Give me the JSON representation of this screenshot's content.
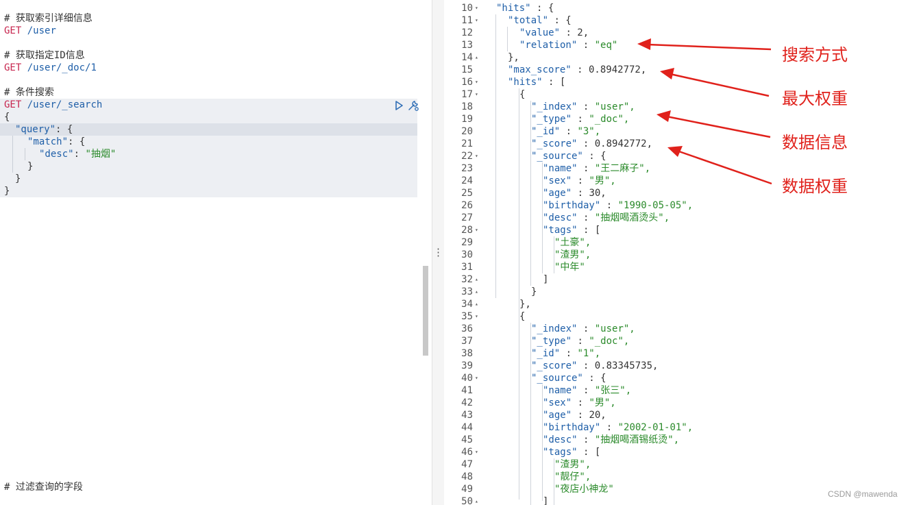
{
  "left_editor": {
    "lines": [
      {
        "comment": "# 获取索引详细信息"
      },
      {
        "method": "GET",
        "path": "/user"
      },
      {
        "comment": "# 获取指定ID信息"
      },
      {
        "method": "GET",
        "path": "/user/_doc/1"
      },
      {
        "comment": "# 条件搜索"
      },
      {
        "method": "GET",
        "path": "/user/_search"
      },
      {
        "text": "{"
      },
      {
        "key": "\"query\"",
        "rest": ": {"
      },
      {
        "key": "\"match\"",
        "rest": ": {"
      },
      {
        "key": "\"desc\"",
        "sep": ": ",
        "value": "\"抽烟\""
      },
      {
        "text": "}"
      },
      {
        "text": "}"
      },
      {
        "text": "}"
      },
      {
        "comment": "# 过滤查询的字段"
      }
    ],
    "icons": {
      "run": "play-icon",
      "settings": "wrench-icon"
    }
  },
  "splitter": {
    "handle": "⋮"
  },
  "right_output": {
    "lines": [
      {
        "n": "10",
        "fold": "▾",
        "t": "\"hits\" : {"
      },
      {
        "n": "11",
        "fold": "▾",
        "t": "\"total\" : {"
      },
      {
        "n": "12",
        "t": "\"value\" : 2,"
      },
      {
        "n": "13",
        "t": "\"relation\" : \"eq\""
      },
      {
        "n": "14",
        "fold": "▴",
        "t": "},"
      },
      {
        "n": "15",
        "t": "\"max_score\" : 0.8942772,"
      },
      {
        "n": "16",
        "fold": "▾",
        "t": "\"hits\" : ["
      },
      {
        "n": "17",
        "fold": "▾",
        "t": "{"
      },
      {
        "n": "18",
        "t": "\"_index\" : \"user\","
      },
      {
        "n": "19",
        "t": "\"_type\" : \"_doc\","
      },
      {
        "n": "20",
        "t": "\"_id\" : \"3\","
      },
      {
        "n": "21",
        "t": "\"_score\" : 0.8942772,"
      },
      {
        "n": "22",
        "fold": "▾",
        "t": "\"_source\" : {"
      },
      {
        "n": "23",
        "t": "\"name\" : \"王二麻子\","
      },
      {
        "n": "24",
        "t": "\"sex\" : \"男\","
      },
      {
        "n": "25",
        "t": "\"age\" : 30,"
      },
      {
        "n": "26",
        "t": "\"birthday\" : \"1990-05-05\","
      },
      {
        "n": "27",
        "t": "\"desc\" : \"抽烟喝酒烫头\","
      },
      {
        "n": "28",
        "fold": "▾",
        "t": "\"tags\" : ["
      },
      {
        "n": "29",
        "t": "\"土豪\","
      },
      {
        "n": "30",
        "t": "\"渣男\","
      },
      {
        "n": "31",
        "t": "\"中年\""
      },
      {
        "n": "32",
        "fold": "▴",
        "t": "]"
      },
      {
        "n": "33",
        "fold": "▴",
        "t": "}"
      },
      {
        "n": "34",
        "fold": "▴",
        "t": "},"
      },
      {
        "n": "35",
        "fold": "▾",
        "t": "{"
      },
      {
        "n": "36",
        "t": "\"_index\" : \"user\","
      },
      {
        "n": "37",
        "t": "\"_type\" : \"_doc\","
      },
      {
        "n": "38",
        "t": "\"_id\" : \"1\","
      },
      {
        "n": "39",
        "t": "\"_score\" : 0.83345735,"
      },
      {
        "n": "40",
        "fold": "▾",
        "t": "\"_source\" : {"
      },
      {
        "n": "41",
        "t": "\"name\" : \"张三\","
      },
      {
        "n": "42",
        "t": "\"sex\" : \"男\","
      },
      {
        "n": "43",
        "t": "\"age\" : 20,"
      },
      {
        "n": "44",
        "t": "\"birthday\" : \"2002-01-01\","
      },
      {
        "n": "45",
        "t": "\"desc\" : \"抽烟喝酒锡纸烫\","
      },
      {
        "n": "46",
        "fold": "▾",
        "t": "\"tags\" : ["
      },
      {
        "n": "47",
        "t": "\"渣男\","
      },
      {
        "n": "48",
        "t": "\"靓仔\","
      },
      {
        "n": "49",
        "t": "\"夜店小神龙\""
      },
      {
        "n": "50",
        "fold": "▴",
        "t": "]"
      }
    ]
  },
  "annotations": [
    {
      "label": "搜索方式"
    },
    {
      "label": "最大权重"
    },
    {
      "label": "数据信息"
    },
    {
      "label": "数据权重"
    }
  ],
  "watermark": "CSDN @mawenda",
  "colors": {
    "annotation": "#e0211b",
    "key": "#1f5fa8",
    "string": "#2a8a2a",
    "method": "#c7254e"
  }
}
